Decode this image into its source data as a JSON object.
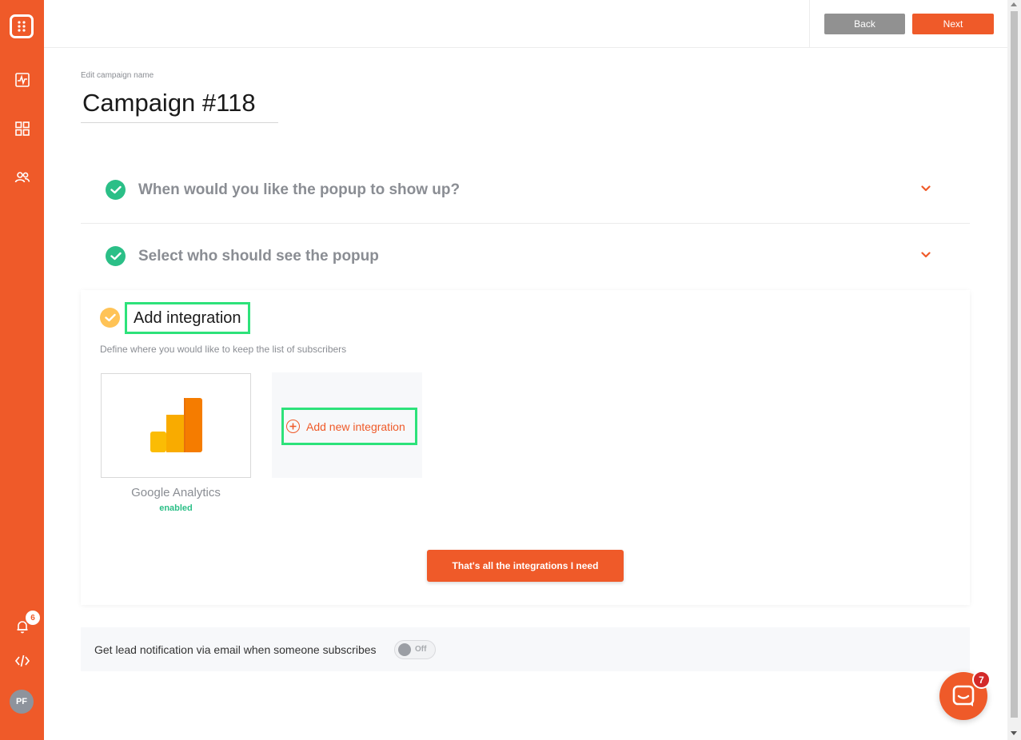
{
  "sidebar": {
    "notification_count": "6",
    "avatar_initials": "PF",
    "icons": [
      "logo-icon",
      "activity-icon",
      "grid-icon",
      "users-icon",
      "bell-icon",
      "code-icon"
    ]
  },
  "topbar": {
    "back_label": "Back",
    "next_label": "Next"
  },
  "campaign": {
    "edit_label": "Edit campaign name",
    "name": "Campaign #118"
  },
  "steps": [
    {
      "title": "When would you like the popup to show up?",
      "status": "complete"
    },
    {
      "title": "Select who should see the popup",
      "status": "complete"
    }
  ],
  "integration": {
    "title": "Add integration",
    "subtitle": "Define where you would like to keep the list of subscribers",
    "items": [
      {
        "name": "Google Analytics",
        "status": "enabled"
      }
    ],
    "add_label": "Add new integration",
    "done_label": "That's all the integrations I need"
  },
  "lead_notification": {
    "label": "Get lead notification via email when someone subscribes",
    "toggle_state": "Off"
  },
  "chat": {
    "unread_count": "7"
  },
  "colors": {
    "brand": "#ef5a29",
    "success": "#2bbf87",
    "pending": "#ffc356",
    "highlight": "#2de27a"
  }
}
